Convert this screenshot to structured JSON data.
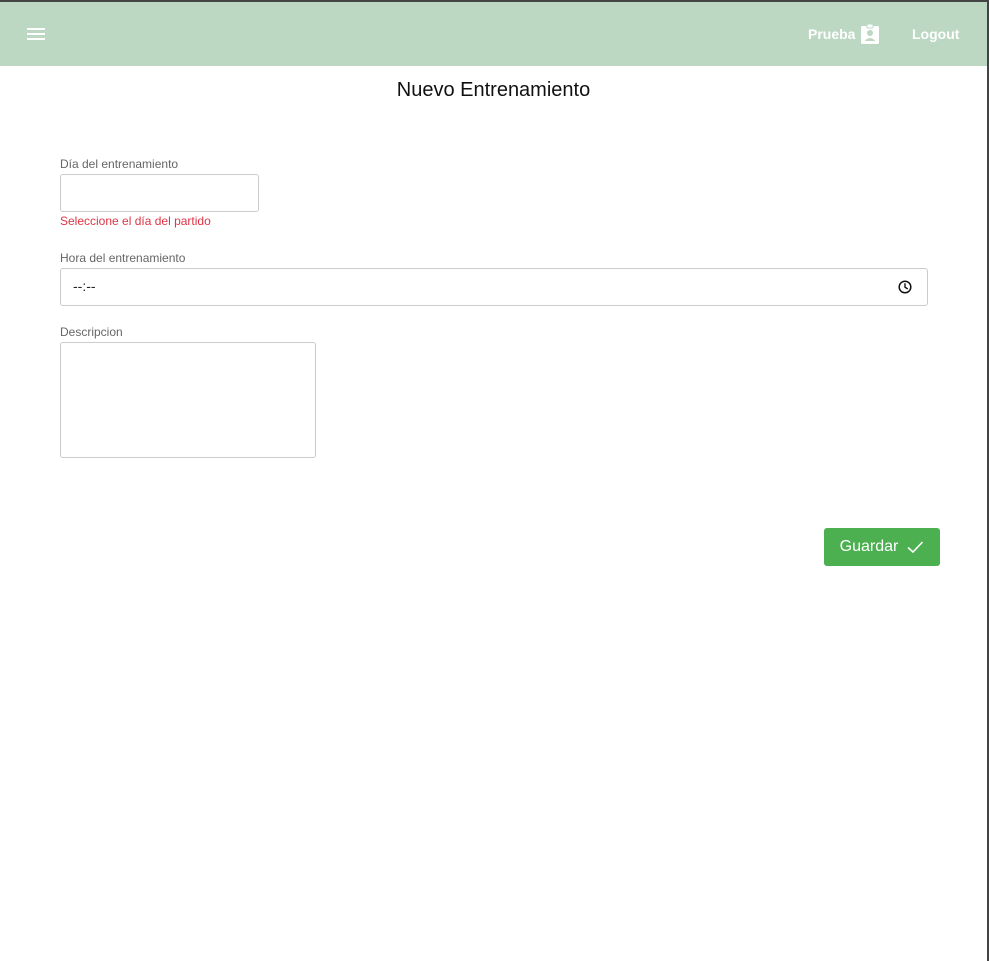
{
  "header": {
    "menu_icon": "hamburger-icon",
    "user_label": "Prueba",
    "user_icon": "contact-badge-icon",
    "logout_label": "Logout",
    "background_color": "#bcd8c3"
  },
  "page": {
    "title": "Nuevo Entrenamiento"
  },
  "form": {
    "date": {
      "label": "Día del entrenamiento",
      "value": "",
      "error": "Seleccione el día del partido",
      "error_color": "#dc3545"
    },
    "time": {
      "label": "Hora del entrenamiento",
      "value": "--:--",
      "icon": "clock-icon"
    },
    "description": {
      "label": "Descripcion",
      "value": ""
    },
    "save": {
      "label": "Guardar",
      "icon": "check-icon",
      "color": "#4caf50"
    }
  }
}
